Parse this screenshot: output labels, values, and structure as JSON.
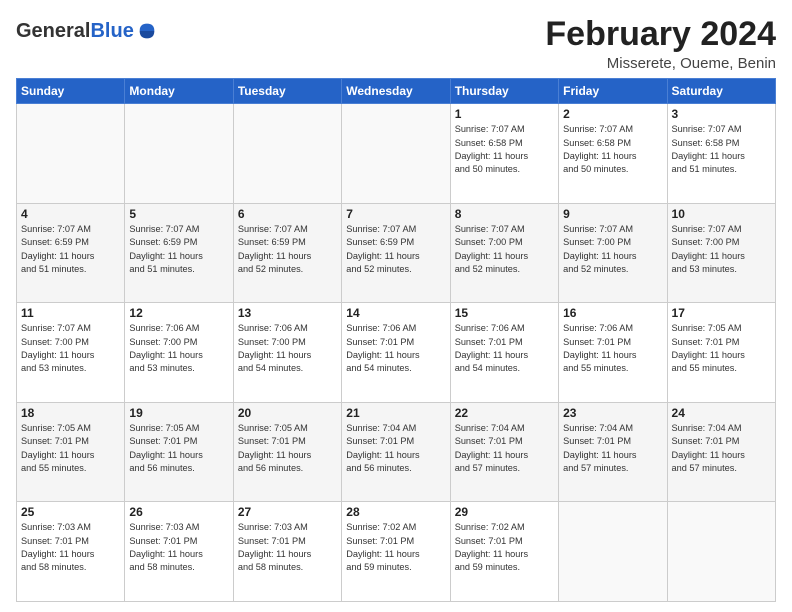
{
  "logo": {
    "general": "General",
    "blue": "Blue"
  },
  "header": {
    "month_year": "February 2024",
    "location": "Misserete, Oueme, Benin"
  },
  "days_of_week": [
    "Sunday",
    "Monday",
    "Tuesday",
    "Wednesday",
    "Thursday",
    "Friday",
    "Saturday"
  ],
  "weeks": [
    [
      {
        "day": "",
        "info": ""
      },
      {
        "day": "",
        "info": ""
      },
      {
        "day": "",
        "info": ""
      },
      {
        "day": "",
        "info": ""
      },
      {
        "day": "1",
        "info": "Sunrise: 7:07 AM\nSunset: 6:58 PM\nDaylight: 11 hours\nand 50 minutes."
      },
      {
        "day": "2",
        "info": "Sunrise: 7:07 AM\nSunset: 6:58 PM\nDaylight: 11 hours\nand 50 minutes."
      },
      {
        "day": "3",
        "info": "Sunrise: 7:07 AM\nSunset: 6:58 PM\nDaylight: 11 hours\nand 51 minutes."
      }
    ],
    [
      {
        "day": "4",
        "info": "Sunrise: 7:07 AM\nSunset: 6:59 PM\nDaylight: 11 hours\nand 51 minutes."
      },
      {
        "day": "5",
        "info": "Sunrise: 7:07 AM\nSunset: 6:59 PM\nDaylight: 11 hours\nand 51 minutes."
      },
      {
        "day": "6",
        "info": "Sunrise: 7:07 AM\nSunset: 6:59 PM\nDaylight: 11 hours\nand 52 minutes."
      },
      {
        "day": "7",
        "info": "Sunrise: 7:07 AM\nSunset: 6:59 PM\nDaylight: 11 hours\nand 52 minutes."
      },
      {
        "day": "8",
        "info": "Sunrise: 7:07 AM\nSunset: 7:00 PM\nDaylight: 11 hours\nand 52 minutes."
      },
      {
        "day": "9",
        "info": "Sunrise: 7:07 AM\nSunset: 7:00 PM\nDaylight: 11 hours\nand 52 minutes."
      },
      {
        "day": "10",
        "info": "Sunrise: 7:07 AM\nSunset: 7:00 PM\nDaylight: 11 hours\nand 53 minutes."
      }
    ],
    [
      {
        "day": "11",
        "info": "Sunrise: 7:07 AM\nSunset: 7:00 PM\nDaylight: 11 hours\nand 53 minutes."
      },
      {
        "day": "12",
        "info": "Sunrise: 7:06 AM\nSunset: 7:00 PM\nDaylight: 11 hours\nand 53 minutes."
      },
      {
        "day": "13",
        "info": "Sunrise: 7:06 AM\nSunset: 7:00 PM\nDaylight: 11 hours\nand 54 minutes."
      },
      {
        "day": "14",
        "info": "Sunrise: 7:06 AM\nSunset: 7:01 PM\nDaylight: 11 hours\nand 54 minutes."
      },
      {
        "day": "15",
        "info": "Sunrise: 7:06 AM\nSunset: 7:01 PM\nDaylight: 11 hours\nand 54 minutes."
      },
      {
        "day": "16",
        "info": "Sunrise: 7:06 AM\nSunset: 7:01 PM\nDaylight: 11 hours\nand 55 minutes."
      },
      {
        "day": "17",
        "info": "Sunrise: 7:05 AM\nSunset: 7:01 PM\nDaylight: 11 hours\nand 55 minutes."
      }
    ],
    [
      {
        "day": "18",
        "info": "Sunrise: 7:05 AM\nSunset: 7:01 PM\nDaylight: 11 hours\nand 55 minutes."
      },
      {
        "day": "19",
        "info": "Sunrise: 7:05 AM\nSunset: 7:01 PM\nDaylight: 11 hours\nand 56 minutes."
      },
      {
        "day": "20",
        "info": "Sunrise: 7:05 AM\nSunset: 7:01 PM\nDaylight: 11 hours\nand 56 minutes."
      },
      {
        "day": "21",
        "info": "Sunrise: 7:04 AM\nSunset: 7:01 PM\nDaylight: 11 hours\nand 56 minutes."
      },
      {
        "day": "22",
        "info": "Sunrise: 7:04 AM\nSunset: 7:01 PM\nDaylight: 11 hours\nand 57 minutes."
      },
      {
        "day": "23",
        "info": "Sunrise: 7:04 AM\nSunset: 7:01 PM\nDaylight: 11 hours\nand 57 minutes."
      },
      {
        "day": "24",
        "info": "Sunrise: 7:04 AM\nSunset: 7:01 PM\nDaylight: 11 hours\nand 57 minutes."
      }
    ],
    [
      {
        "day": "25",
        "info": "Sunrise: 7:03 AM\nSunset: 7:01 PM\nDaylight: 11 hours\nand 58 minutes."
      },
      {
        "day": "26",
        "info": "Sunrise: 7:03 AM\nSunset: 7:01 PM\nDaylight: 11 hours\nand 58 minutes."
      },
      {
        "day": "27",
        "info": "Sunrise: 7:03 AM\nSunset: 7:01 PM\nDaylight: 11 hours\nand 58 minutes."
      },
      {
        "day": "28",
        "info": "Sunrise: 7:02 AM\nSunset: 7:01 PM\nDaylight: 11 hours\nand 59 minutes."
      },
      {
        "day": "29",
        "info": "Sunrise: 7:02 AM\nSunset: 7:01 PM\nDaylight: 11 hours\nand 59 minutes."
      },
      {
        "day": "",
        "info": ""
      },
      {
        "day": "",
        "info": ""
      }
    ]
  ]
}
